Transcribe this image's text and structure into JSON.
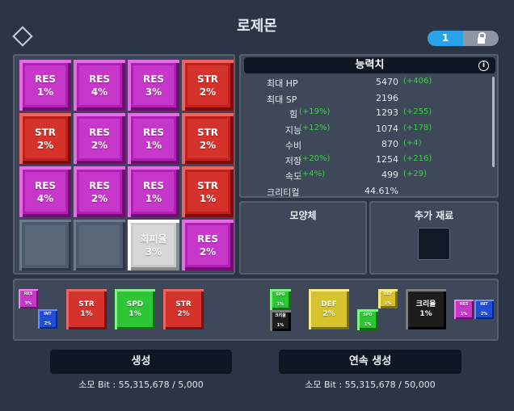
{
  "title": "로제몬",
  "toggle": {
    "count": "1"
  },
  "grid": [
    {
      "type": "RES",
      "label": "RES",
      "pct": "1%"
    },
    {
      "type": "RES",
      "label": "RES",
      "pct": "4%"
    },
    {
      "type": "RES",
      "label": "RES",
      "pct": "3%"
    },
    {
      "type": "STR",
      "label": "STR",
      "pct": "2%"
    },
    {
      "type": "STR",
      "label": "STR",
      "pct": "2%"
    },
    {
      "type": "RES",
      "label": "RES",
      "pct": "2%"
    },
    {
      "type": "RES",
      "label": "RES",
      "pct": "1%"
    },
    {
      "type": "STR",
      "label": "STR",
      "pct": "2%"
    },
    {
      "type": "RES",
      "label": "RES",
      "pct": "4%"
    },
    {
      "type": "RES",
      "label": "RES",
      "pct": "2%"
    },
    {
      "type": "RES",
      "label": "RES",
      "pct": "1%"
    },
    {
      "type": "STR",
      "label": "STR",
      "pct": "1%"
    },
    {
      "type": "EMPTY",
      "label": "",
      "pct": ""
    },
    {
      "type": "EMPTY",
      "label": "",
      "pct": ""
    },
    {
      "type": "EVD",
      "label": "회피율",
      "pct": "3%"
    },
    {
      "type": "RES",
      "label": "RES",
      "pct": "2%"
    }
  ],
  "stats": {
    "header": "능력치",
    "info": "i",
    "rows": [
      {
        "label": "최대 HP",
        "pct": "",
        "value": "5470",
        "bonus": "(+406)"
      },
      {
        "label": "최대 SP",
        "pct": "",
        "value": "2196",
        "bonus": ""
      },
      {
        "label": "힘",
        "pct": "(+19%)",
        "value": "1293",
        "bonus": "(+255)"
      },
      {
        "label": "지능",
        "pct": "(+12%)",
        "value": "1074",
        "bonus": "(+178)"
      },
      {
        "label": "수비",
        "pct": "",
        "value": "870",
        "bonus": "(+4)"
      },
      {
        "label": "저항",
        "pct": "(+20%)",
        "value": "1254",
        "bonus": "(+216)"
      },
      {
        "label": "속도",
        "pct": "(+4%)",
        "value": "499",
        "bonus": "(+29)"
      },
      {
        "label": "크리티컬",
        "pct": "",
        "value": "44.61%",
        "bonus": ""
      }
    ]
  },
  "shape_box": {
    "title": "모양체"
  },
  "material_box": {
    "title": "추가 재료"
  },
  "pieces": {
    "p1_res": {
      "label": "RES",
      "pct": "3%"
    },
    "p1_int": {
      "label": "INT",
      "pct": "2%"
    },
    "p2": {
      "label": "STR",
      "pct": "1%"
    },
    "p3": {
      "label": "SPD",
      "pct": "1%"
    },
    "p4": {
      "label": "STR",
      "pct": "2%"
    },
    "p5_spd": {
      "label": "SPD",
      "pct": "1%"
    },
    "p5_crit": {
      "label": "크리율",
      "pct": "1%"
    },
    "p6": {
      "label": "DEF",
      "pct": "2%"
    },
    "p7_def": {
      "label": "DEF",
      "pct": "1%"
    },
    "p7_spd": {
      "label": "SPD",
      "pct": "1%"
    },
    "p8": {
      "label": "크리율",
      "pct": "1%"
    },
    "p9_res": {
      "label": "RES",
      "pct": "1%"
    },
    "p9_int": {
      "label": "INT",
      "pct": "2%"
    }
  },
  "actions": {
    "generate": "생성",
    "generate_cost": "소모 Bit :  55,315,678 / 5,000",
    "continuous": "연속 생성",
    "continuous_cost": "소모 Bit :  55,315,678 / 50,000"
  }
}
